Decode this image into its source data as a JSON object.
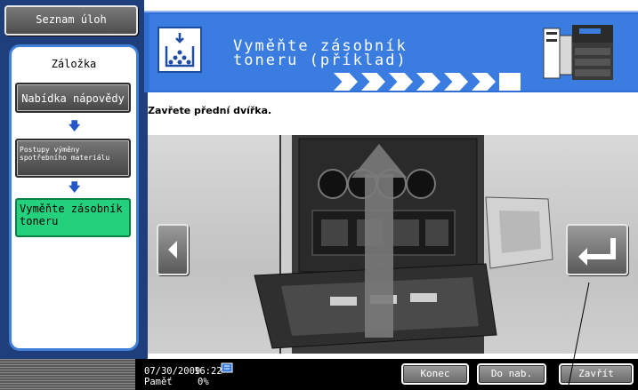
{
  "left_panel": {
    "job_list_label": "Seznam úloh",
    "tab_label": "Záložka",
    "help_menu_label": "Nabídka nápovědy",
    "steps_label": "Postupy výměny spotřebního materiálu",
    "replace_toner_label": "Vyměňte zásobník toneru"
  },
  "header": {
    "title_line1": "Vyměňte zásobník",
    "title_line2": "toneru (příklad)",
    "progress_steps": 7
  },
  "message": "Zavřete přední dvířka.",
  "illustration": {
    "subject": "copier-front-door-open",
    "arrow_direction": "up"
  },
  "status_bar": {
    "date": "07/30/2009",
    "time": "16:22",
    "memory_label": "Paměť",
    "memory_value": "0%"
  },
  "buttons": {
    "end_label": "Konec",
    "to_menu_label": "Do nab.",
    "close_label": "Zavřít"
  },
  "colors": {
    "frame_blue": "#1e3f7c",
    "header_blue": "#3a7ce0",
    "active_green": "#23d17c"
  }
}
